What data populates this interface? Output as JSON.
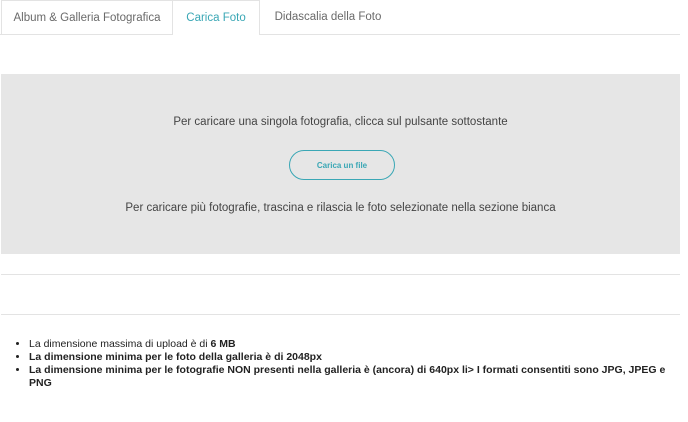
{
  "tabs": [
    {
      "label": "Album & Galleria Fotografica",
      "active": false
    },
    {
      "label": "Carica Foto",
      "active": true
    },
    {
      "label": "Didascalia della Foto",
      "active": false
    }
  ],
  "upload": {
    "single_instruction": "Per caricare una singola fotografia, clicca sul pulsante sottostante",
    "button_label": "Carica un file",
    "multi_instruction": "Per caricare più fotografie, trascina e rilascia le foto selezionate nella sezione bianca"
  },
  "rules": {
    "max_size_prefix": "La dimensione massima di upload è di ",
    "max_size_value": "6 MB",
    "min_gallery": "La dimensione minima per le foto della galleria è di 2048px",
    "min_other": "La dimensione minima per le fotografie NON presenti nella galleria è (ancora) di 640px li> I formati consentiti sono JPG, JPEG e PNG"
  },
  "colors": {
    "accent": "#3aa7b5",
    "upload_zone_bg": "#e6e6e6"
  }
}
